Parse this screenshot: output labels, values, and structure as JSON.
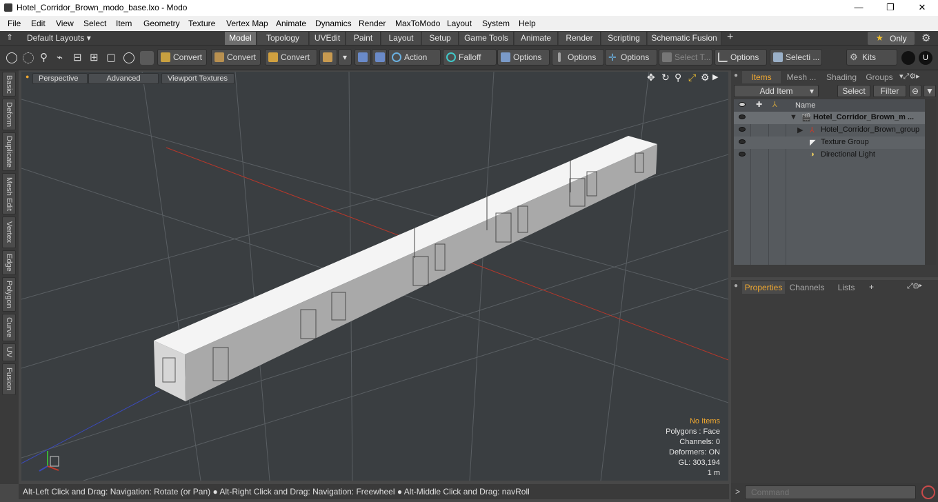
{
  "window": {
    "title": "Hotel_Corridor_Brown_modo_base.lxo - Modo",
    "minimize": "—",
    "maximize": "❐",
    "close": "✕"
  },
  "menu": [
    "File",
    "Edit",
    "View",
    "Select",
    "Item",
    "Geometry",
    "Texture",
    "Vertex Map",
    "Animate",
    "Dynamics",
    "Render",
    "MaxToModo",
    "Layout",
    "System",
    "Help"
  ],
  "layouts": {
    "selector": "Default Layouts ▾",
    "tabs": [
      "Model",
      "Topology",
      "UVEdit",
      "Paint",
      "Layout",
      "Setup",
      "Game Tools",
      "Animate",
      "Render",
      "Scripting",
      "Schematic Fusion"
    ],
    "active": "Model",
    "only_label": "Only"
  },
  "toolbar": {
    "convert1": "Convert",
    "convert2": "Convert",
    "convert3": "Convert",
    "action": "Action",
    "falloff": "Falloff",
    "options1": "Options",
    "options2": "Options",
    "options3": "Options",
    "select_t": "Select T...",
    "options4": "Options",
    "selecti": "Selecti ...",
    "kits": "Kits"
  },
  "left_tabs": [
    "Basic",
    "Deform",
    "Duplicate",
    "Mesh Edit",
    "Vertex",
    "Edge",
    "Polygon",
    "Curve",
    "UV",
    "Fusion"
  ],
  "viewport": {
    "tabs": [
      "Perspective",
      "Advanced",
      "Viewport Textures"
    ],
    "info": {
      "no_items": "No Items",
      "polygons": "Polygons : Face",
      "channels": "Channels: 0",
      "deformers": "Deformers: ON",
      "gl": "GL: 303,194",
      "scale": "1 m"
    }
  },
  "status": {
    "text": "Alt-Left Click and Drag: Navigation: Rotate (or Pan) ● Alt-Right Click and Drag: Navigation: Freewheel ● Alt-Middle Click and Drag: navRoll"
  },
  "items_panel": {
    "tabs": [
      "Items",
      "Mesh ...",
      "Shading",
      "Groups"
    ],
    "add_item": "Add Item",
    "select": "Select",
    "filter": "Filter",
    "name_header": "Name",
    "items": [
      {
        "label": "Hotel_Corridor_Brown_m ...",
        "bold": true
      },
      {
        "label": "Hotel_Corridor_Brown_group",
        "bold": false
      },
      {
        "label": "Texture Group",
        "bold": false
      },
      {
        "label": "Directional Light",
        "bold": false
      }
    ]
  },
  "properties_panel": {
    "tabs": [
      "Properties",
      "Channels",
      "Lists"
    ]
  },
  "command": {
    "placeholder": "Command"
  },
  "colors": {
    "accent": "#f0a830",
    "viewport_bg": "#3a3e41",
    "x_axis": "#c83a2a",
    "z_axis": "#3a4ab8"
  }
}
